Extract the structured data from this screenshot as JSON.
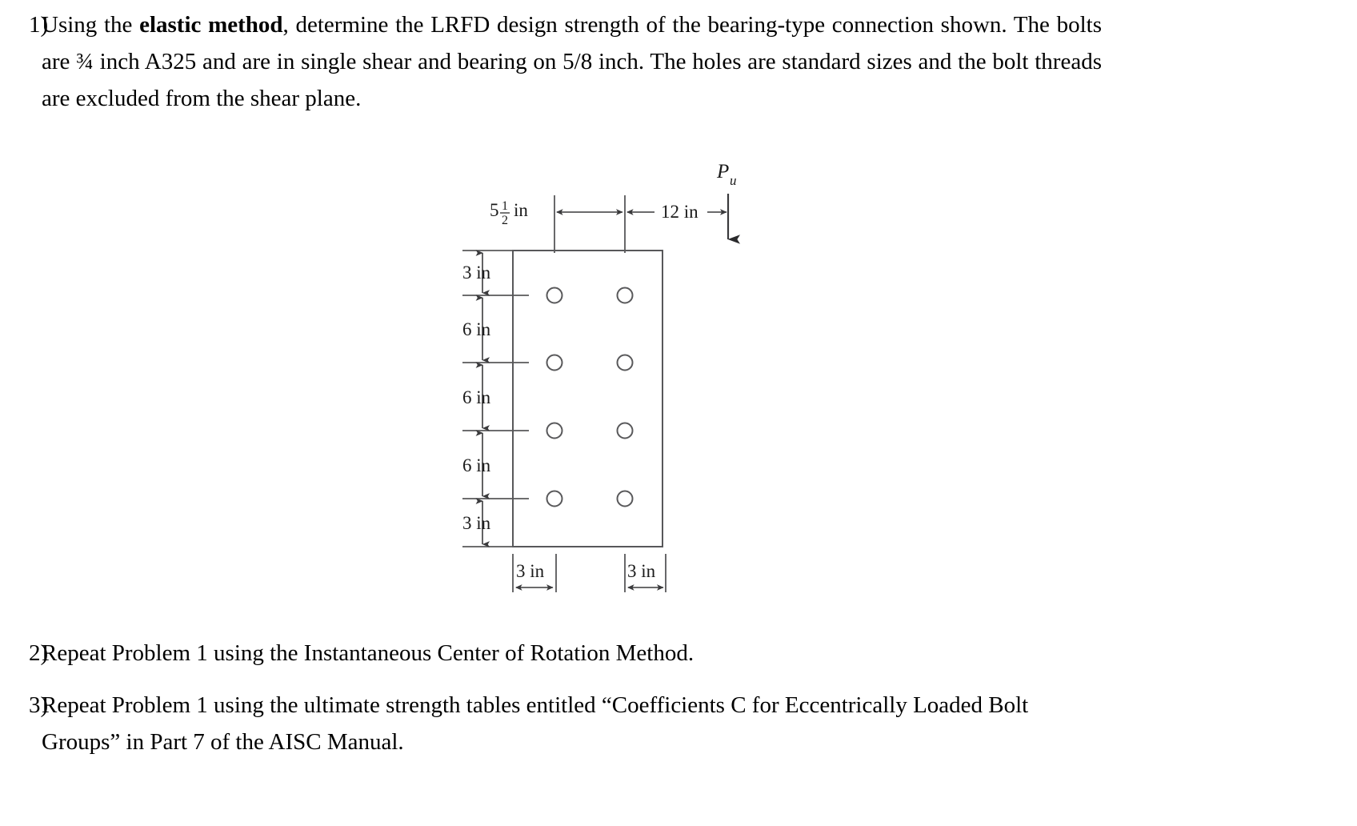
{
  "document": {
    "kind": "homework-problem-sheet",
    "title": "Bolted Connection Problem Set"
  },
  "problems": [
    {
      "number": "1)",
      "segments": [
        {
          "text": "Using  the  ",
          "bold": false
        },
        {
          "text": "elastic  method",
          "bold": true
        },
        {
          "text": ",  determine  the  LRFD  design  strength  of  the  bearing-type connection shown.  The bolts are ¾ inch A325 and are in single shear and bearing on 5/8 inch.  The holes are standard sizes and the bolt threads are excluded from the shear plane.",
          "bold": false
        }
      ],
      "plain_text": "Using the elastic method, determine the LRFD design strength of the bearing-type connection shown.  The bolts are ¾ inch A325 and are in single shear and bearing on 5/8 inch.  The holes are standard sizes and the bolt threads are excluded from the shear plane."
    },
    {
      "number": "2)",
      "plain_text": "Repeat Problem 1 using the Instantaneous Center of Rotation Method."
    },
    {
      "number": "3)",
      "plain_text": "Repeat Problem 1 using the ultimate strength tables entitled “Coefficients C for Eccentrically Loaded Bolt Groups” in Part 7 of the AISC Manual."
    }
  ],
  "figure": {
    "name": "eccentrically-loaded-bolt-group-diagram",
    "load_label": {
      "symbol": "P",
      "subscript": "u",
      "direction": "down"
    },
    "top_dimensions": [
      {
        "id": "edge-to-first-column",
        "value": "5",
        "fraction_numerator": "1",
        "fraction_denominator": "2",
        "unit": "in",
        "display": "5½ in",
        "style": "label-left-of-dimension"
      },
      {
        "id": "column-to-load",
        "value": "12",
        "unit": "in",
        "display": "12 in",
        "style": "inline-arrows"
      }
    ],
    "vertical_dimensions": [
      {
        "id": "top-edge-to-row-1",
        "display": "3 in"
      },
      {
        "id": "row-1-to-row-2",
        "display": "6 in"
      },
      {
        "id": "row-2-to-row-3",
        "display": "6 in"
      },
      {
        "id": "row-3-to-row-4",
        "display": "6 in"
      },
      {
        "id": "row-4-to-bottom-edge",
        "display": "3 in"
      }
    ],
    "bottom_dimensions": [
      {
        "id": "left-edge-to-column-1",
        "display": "3 in"
      },
      {
        "id": "column-2-to-right-edge",
        "display": "3 in"
      }
    ],
    "bolt_grid": {
      "rows": 4,
      "columns": 2,
      "total_bolts": 8,
      "hole_shape": "circle"
    },
    "colors": {
      "line": "#58585a",
      "text": "#1a1a1a",
      "background": "#ffffff"
    }
  }
}
